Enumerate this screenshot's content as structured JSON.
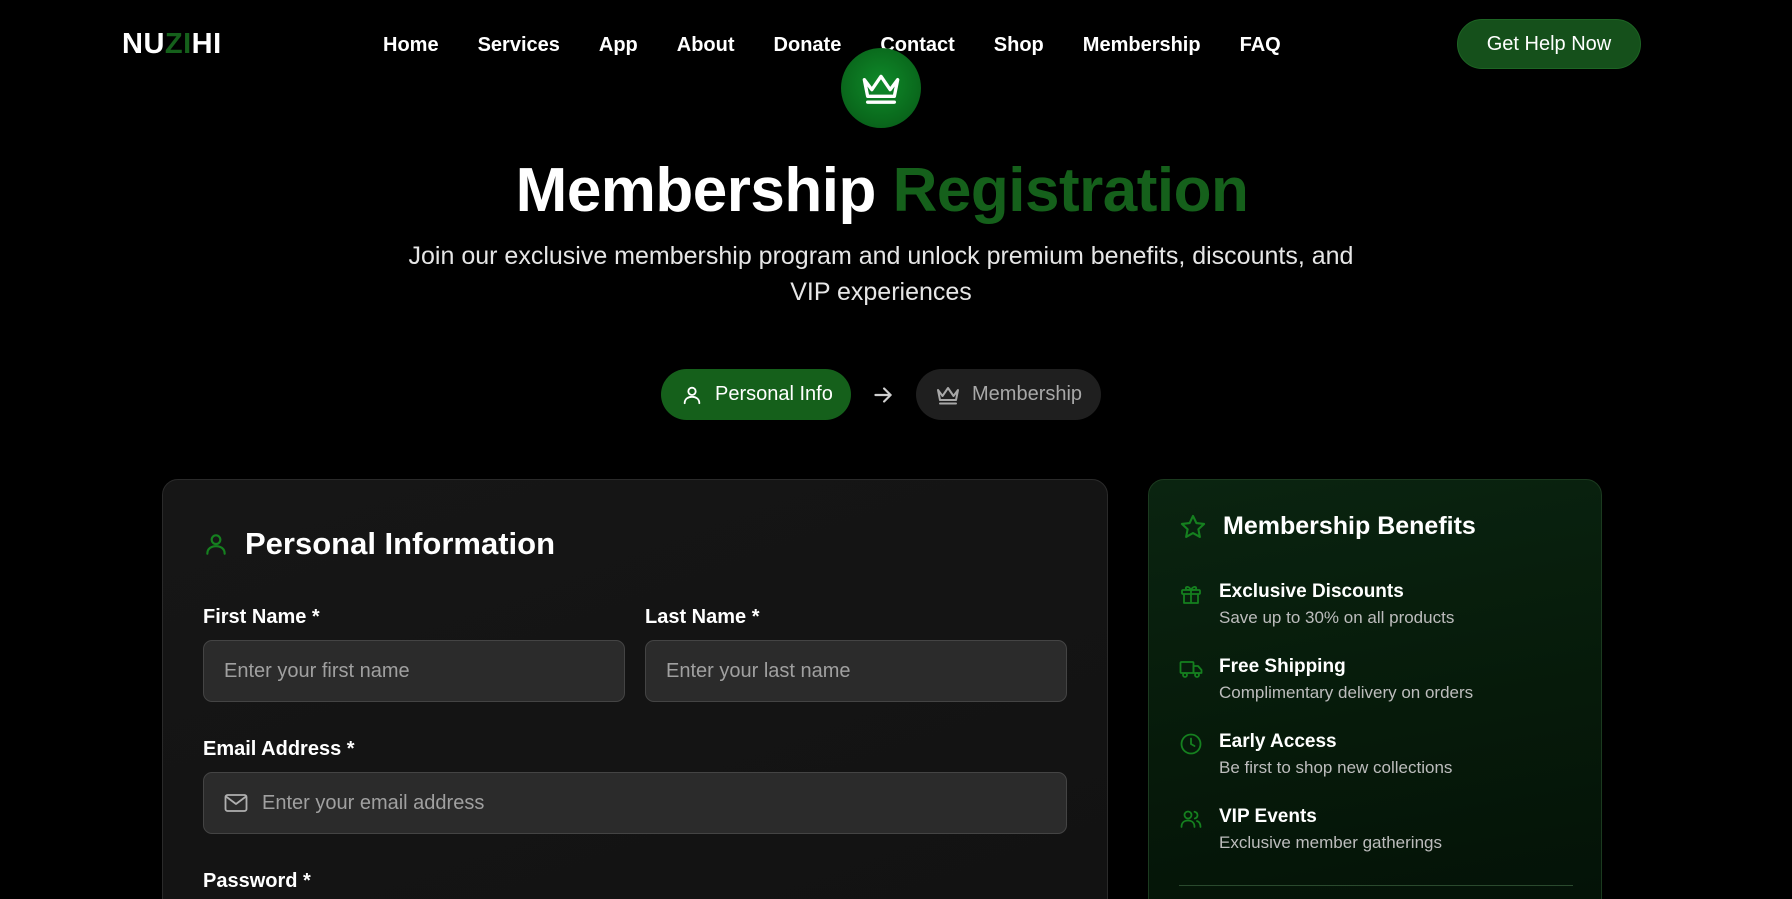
{
  "nav": {
    "logo_a": "NU",
    "logo_b": "ZI",
    "logo_c": "HI",
    "links": [
      "Home",
      "Services",
      "App",
      "About",
      "Donate",
      "Contact",
      "Shop",
      "Membership",
      "FAQ"
    ],
    "cta": "Get Help Now"
  },
  "hero": {
    "icon": "crown-icon",
    "title_main": "Membership",
    "title_accent": "Registration",
    "subtitle": "Join our exclusive membership program and unlock premium benefits, discounts, and VIP experiences"
  },
  "steps": {
    "active": {
      "label": "Personal Info",
      "icon": "user-icon"
    },
    "inactive": {
      "label": "Membership",
      "icon": "crown-icon"
    }
  },
  "form": {
    "title": "Personal Information",
    "first_name": {
      "label": "First Name *",
      "placeholder": "Enter your first name"
    },
    "last_name": {
      "label": "Last Name *",
      "placeholder": "Enter your last name"
    },
    "email": {
      "label": "Email Address *",
      "placeholder": "Enter your email address"
    },
    "password": {
      "label": "Password *"
    }
  },
  "benefits": {
    "title": "Membership Benefits",
    "items": [
      {
        "icon": "gift-icon",
        "title": "Exclusive Discounts",
        "desc": "Save up to 30% on all products"
      },
      {
        "icon": "truck-icon",
        "title": "Free Shipping",
        "desc": "Complimentary delivery on orders"
      },
      {
        "icon": "clock-icon",
        "title": "Early Access",
        "desc": "Be first to shop new collections"
      },
      {
        "icon": "users-icon",
        "title": "VIP Events",
        "desc": "Exclusive member gatherings"
      }
    ]
  },
  "colors": {
    "background": "#000000",
    "brand_green": "#15601b",
    "accent_green": "#0a6b1d",
    "card": "#141414",
    "field": "#2b2b2b"
  }
}
